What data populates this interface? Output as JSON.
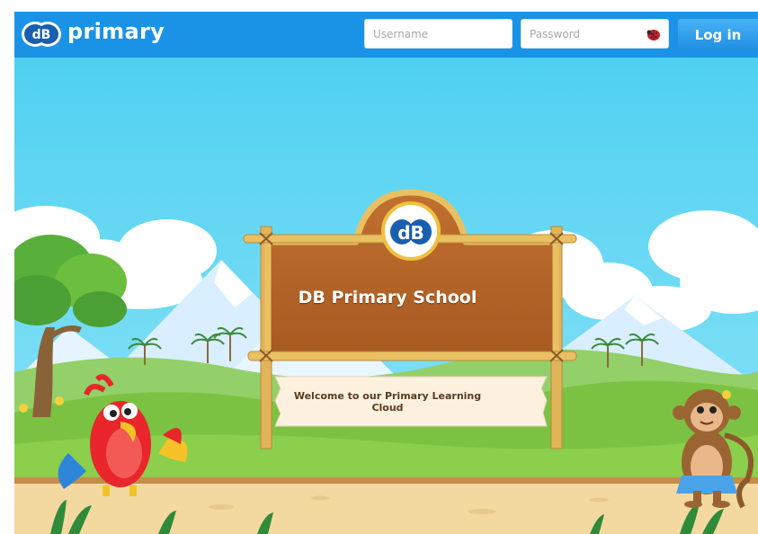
{
  "header": {
    "logo_text": "primary",
    "username_placeholder": "Username",
    "password_placeholder": "Password",
    "login_label": "Log in"
  },
  "sign": {
    "title": "DB Primary School",
    "welcome": "Welcome to our Primary Learning Cloud"
  },
  "colors": {
    "header_bg": "#1a93e6",
    "sky": "#5fd6f3",
    "grass": "#7cc242",
    "path": "#f3d9a0",
    "sign_wood": "#b5652a",
    "bamboo": "#e9c062"
  }
}
